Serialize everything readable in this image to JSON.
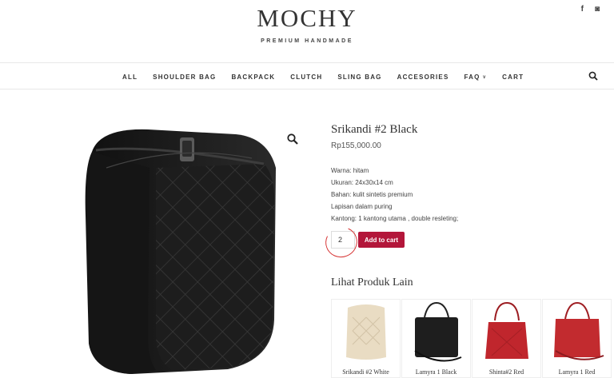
{
  "header": {
    "logo": "MOCHY",
    "tagline": "PREMIUM HANDMADE",
    "social": [
      {
        "icon": "facebook-icon",
        "glyph": "f"
      },
      {
        "icon": "instagram-icon",
        "glyph": "◙"
      }
    ]
  },
  "nav": {
    "items": [
      {
        "label": "ALL"
      },
      {
        "label": "SHOULDER BAG"
      },
      {
        "label": "BACKPACK"
      },
      {
        "label": "CLUTCH"
      },
      {
        "label": "SLING BAG"
      },
      {
        "label": "ACCESORIES"
      },
      {
        "label": "FAQ",
        "dropdown": true
      },
      {
        "label": "CART"
      }
    ],
    "search_icon": "search-icon"
  },
  "product": {
    "title": "Srikandi #2 Black",
    "price": "Rp155,000.00",
    "details": [
      "Warna: hitam",
      "Ukuran: 24x30x14 cm",
      "Bahan: kulit sintetis premium",
      "Lapisan dalam puring",
      "Kantong: 1 kantong utama , double resleting;"
    ],
    "quantity": "2",
    "add_to_cart": "Add to cart",
    "image_color": "#1c1c1c"
  },
  "related": {
    "title": "Lihat Produk Lain",
    "items": [
      {
        "name": "Srikandi #2 White",
        "color": "#e9dcc3"
      },
      {
        "name": "Lamyra 1 Black",
        "color": "#1e1e1e"
      },
      {
        "name": "Shinta#2 Red",
        "color": "#c0262d"
      },
      {
        "name": "Lamyra 1 Red",
        "color": "#c22b2f"
      }
    ]
  },
  "colors": {
    "accent": "#b3163a",
    "annotation": "#d63232"
  }
}
